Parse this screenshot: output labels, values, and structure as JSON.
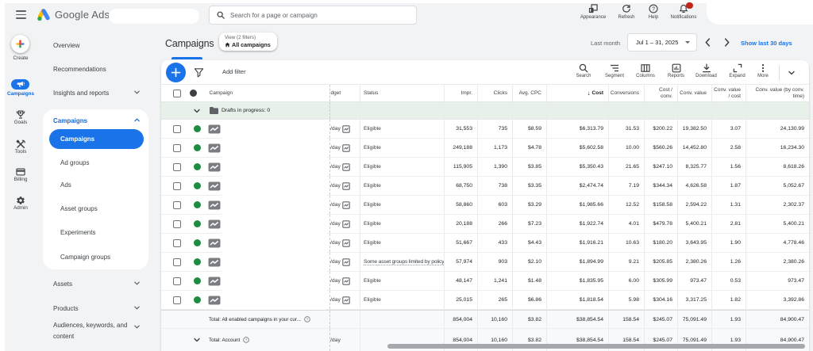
{
  "topbar": {
    "brand": "Google Ads",
    "search_placeholder": "Search for a page or campaign",
    "actions": [
      {
        "label": "Appearance"
      },
      {
        "label": "Refresh"
      },
      {
        "label": "Help"
      },
      {
        "label": "Notifications"
      }
    ]
  },
  "rail": {
    "items": [
      {
        "label": "Create"
      },
      {
        "label": "Campaigns",
        "active": true
      },
      {
        "label": "Goals"
      },
      {
        "label": "Tools"
      },
      {
        "label": "Billing"
      },
      {
        "label": "Admin"
      }
    ]
  },
  "nav": {
    "items_top": [
      "Overview",
      "Recommendations",
      "Insights and reports"
    ],
    "section_title": "Campaigns",
    "section_items": [
      "Campaigns",
      "Ad groups",
      "Ads",
      "Asset groups",
      "Experiments",
      "Campaign groups"
    ],
    "selected_item": "Campaigns",
    "items_bottom": [
      "Assets",
      "Products",
      "Audiences, keywords, and content"
    ]
  },
  "header": {
    "title": "Campaigns",
    "view_label": "View (2 filters)",
    "view_value": "All campaigns",
    "range_label": "Last month",
    "date_range": "Jul 1 – 31, 2025",
    "show_link": "Show last 30 days"
  },
  "toolbar": {
    "add_filter": "Add filter",
    "actions": [
      "Search",
      "Segment",
      "Columns",
      "Reports",
      "Download",
      "Expand",
      "More"
    ]
  },
  "table": {
    "sort_indicator": "↓",
    "columns": [
      "",
      "●",
      "Campaign",
      "dget",
      "Status",
      "Impr.",
      "Clicks",
      "Avg. CPC",
      "Cost",
      "Conversions",
      "Cost /\nconv.",
      "Conv. value",
      "Conv. value\n/ cost",
      "Conv. value (by conv.\ntime)"
    ],
    "drafts_label": "Drafts in progress: 0",
    "budget_suffix": "/day",
    "rows": [
      {
        "status": "Eligible",
        "impr": "31,553",
        "clicks": "735",
        "cpc": "$8.59",
        "cost": "$6,313.79",
        "conv": "31.53",
        "cost_conv": "$200.22",
        "value": "19,382.50",
        "value_cost": "3.07",
        "value_time": "24,130.99"
      },
      {
        "status": "Eligible",
        "impr": "249,188",
        "clicks": "1,173",
        "cpc": "$4.78",
        "cost": "$5,602.58",
        "conv": "10.00",
        "cost_conv": "$560.26",
        "value": "14,452.80",
        "value_cost": "2.58",
        "value_time": "16,234.30"
      },
      {
        "status": "Eligible",
        "impr": "115,905",
        "clicks": "1,390",
        "cpc": "$3.85",
        "cost": "$5,350.43",
        "conv": "21.65",
        "cost_conv": "$247.10",
        "value": "8,325.77",
        "value_cost": "1.56",
        "value_time": "8,618.26"
      },
      {
        "status": "Eligible",
        "impr": "68,750",
        "clicks": "738",
        "cpc": "$3.35",
        "cost": "$2,474.74",
        "conv": "7.19",
        "cost_conv": "$344.34",
        "value": "4,626.58",
        "value_cost": "1.87",
        "value_time": "5,052.67"
      },
      {
        "status": "Eligible",
        "impr": "58,860",
        "clicks": "603",
        "cpc": "$3.29",
        "cost": "$1,985.66",
        "conv": "12.52",
        "cost_conv": "$158.58",
        "value": "2,594.22",
        "value_cost": "1.31",
        "value_time": "2,302.37"
      },
      {
        "status": "Eligible",
        "impr": "20,188",
        "clicks": "266",
        "cpc": "$7.23",
        "cost": "$1,922.74",
        "conv": "4.01",
        "cost_conv": "$479.78",
        "value": "5,400.21",
        "value_cost": "2.81",
        "value_time": "5,400.21"
      },
      {
        "status": "Eligible",
        "impr": "51,667",
        "clicks": "433",
        "cpc": "$4.43",
        "cost": "$1,916.21",
        "conv": "10.63",
        "cost_conv": "$180.20",
        "value": "3,643.95",
        "value_cost": "1.90",
        "value_time": "4,778.46"
      },
      {
        "status": "Some asset groups limited by policy",
        "policy": true,
        "impr": "57,974",
        "clicks": "903",
        "cpc": "$2.10",
        "cost": "$1,894.99",
        "conv": "9.21",
        "cost_conv": "$205.85",
        "value": "2,380.26",
        "value_cost": "1.26",
        "value_time": "2,380.26"
      },
      {
        "status": "Eligible",
        "impr": "48,147",
        "clicks": "1,241",
        "cpc": "$1.48",
        "cost": "$1,835.95",
        "conv": "6.00",
        "cost_conv": "$305.99",
        "value": "973.47",
        "value_cost": "0.53",
        "value_time": "973.47"
      },
      {
        "status": "Eligible",
        "impr": "25,015",
        "clicks": "265",
        "cpc": "$6.86",
        "cost": "$1,818.54",
        "conv": "5.98",
        "cost_conv": "$304.16",
        "value": "3,317.25",
        "value_cost": "1.82",
        "value_time": "3,392.86"
      }
    ],
    "totals": [
      {
        "label": "Total: All enabled campaigns in your cur...",
        "chevron": false,
        "budget": "",
        "impr": "854,004",
        "clicks": "10,160",
        "cpc": "$3.82",
        "cost": "$38,854.54",
        "conv": "158.54",
        "cost_conv": "$245.07",
        "value": "75,091.49",
        "value_cost": "1.93",
        "value_time": "84,900.47"
      },
      {
        "label": "Total: Account",
        "chevron": true,
        "budget": "/day",
        "impr": "854,004",
        "clicks": "10,160",
        "cpc": "$3.82",
        "cost": "$38,854.54",
        "conv": "158.54",
        "cost_conv": "$245.07",
        "value": "75,091.49",
        "value_cost": "1.93",
        "value_time": "84,900.47"
      }
    ]
  }
}
